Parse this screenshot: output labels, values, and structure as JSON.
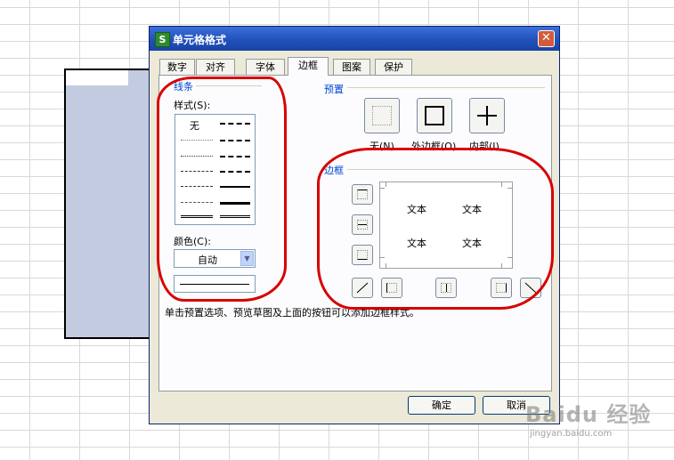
{
  "dialog": {
    "title": "单元格格式",
    "app_icon_letter": "S",
    "close_glyph": "✕"
  },
  "tabs": [
    {
      "label": "数字",
      "active": false
    },
    {
      "label": "对齐",
      "active": false
    },
    {
      "label": "字体",
      "active": false
    },
    {
      "label": "边框",
      "active": true
    },
    {
      "label": "图案",
      "active": false
    },
    {
      "label": "保护",
      "active": false
    }
  ],
  "line_group": {
    "title": "线条",
    "style_label": "样式(S):",
    "none_label": "无",
    "color_label": "颜色(C):",
    "color_value": "自动"
  },
  "presets": {
    "title": "预置",
    "items": [
      {
        "label": "无(N)",
        "icon": "border-none-icon"
      },
      {
        "label": "外边框(O)",
        "icon": "border-outline-icon"
      },
      {
        "label": "内部(I)",
        "icon": "border-inside-icon"
      }
    ]
  },
  "border": {
    "title": "边框",
    "preview_texts": [
      "文本",
      "文本",
      "文本",
      "文本"
    ],
    "hint": "单击预置选项、预览草图及上面的按钮可以添加边框样式。"
  },
  "buttons": {
    "ok": "确定",
    "cancel": "取消"
  },
  "watermark": {
    "brand": "Baidu 经验",
    "url": "jingyan.baidu.com"
  },
  "colors": {
    "titlebar": "#1f4fb8",
    "dialog_bg": "#ece9d8",
    "group_title": "#0046d5",
    "selection": "#c3cbe0",
    "annotation_red": "#d80000"
  }
}
